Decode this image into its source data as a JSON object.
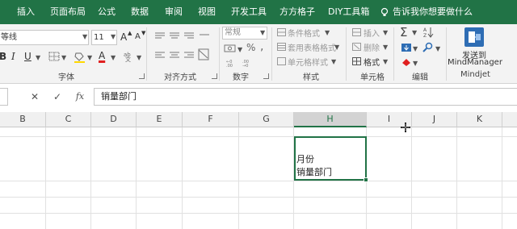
{
  "tabs": [
    "插入",
    "页面布局",
    "公式",
    "数据",
    "审阅",
    "视图",
    "开发工具",
    "方方格子",
    "DIY工具箱"
  ],
  "tell_me": "告诉我你想要做什么",
  "ribbon": {
    "font_name": "等线",
    "font_size": "11",
    "font_grow": "A",
    "font_shrink": "A",
    "bold": "B",
    "italic": "I",
    "underline": "U",
    "font_color_glyph": "A",
    "number_format": "常规",
    "percent": "%",
    "comma": ",",
    "conditional_format": "条件格式",
    "table_format": "套用表格格式",
    "cell_style": "单元格样式",
    "insert": "插入",
    "delete": "删除",
    "format": "格式",
    "sum_glyph": "Σ",
    "mindmanager_label_1": "发送到",
    "mindmanager_label_2": "MindManager",
    "groups": {
      "font": "字体",
      "alignment": "对齐方式",
      "number": "数字",
      "styles": "样式",
      "cells": "单元格",
      "editing": "编辑",
      "mindjet": "Mindjet"
    }
  },
  "formula_bar": {
    "cancel": "✕",
    "enter": "✓",
    "fx": "fx",
    "value": "销量部门"
  },
  "columns": [
    "B",
    "C",
    "D",
    "E",
    "F",
    "G",
    "H",
    "I",
    "J",
    "K"
  ],
  "active_column": "H",
  "cell": {
    "line1": "月份",
    "line2": "销量部门"
  },
  "colors": {
    "accent": "#217346",
    "ribbon_bg": "#f3f3f3",
    "font_color_bar": "#e02020"
  }
}
